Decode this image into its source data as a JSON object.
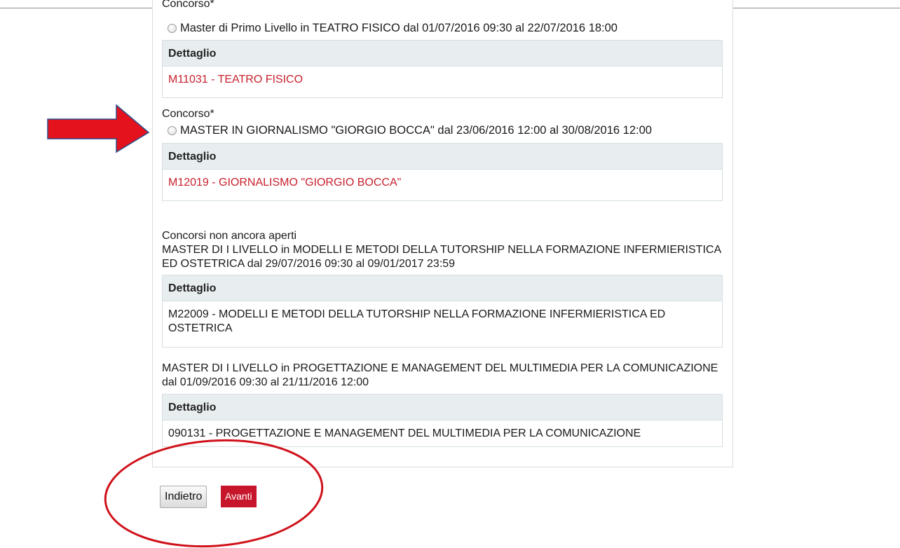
{
  "sections": {
    "open": [
      {
        "label": "Concorso*",
        "option": "Master di Primo Livello in TEATRO FISICO dal 01/07/2016 09:30 al 22/07/2016 18:00",
        "detail_header": "Dettaglio",
        "detail_value": "M11031 - TEATRO FISICO"
      },
      {
        "label": "Concorso*",
        "option": "MASTER IN GIORNALISMO \"GIORGIO BOCCA\" dal 23/06/2016 12:00 al 30/08/2016 12:00",
        "detail_header": "Dettaglio",
        "detail_value": "M12019 - GIORNALISMO \"GIORGIO BOCCA\""
      }
    ],
    "not_open_title": "Concorsi non ancora aperti",
    "not_open": [
      {
        "description": "MASTER DI I LIVELLO in MODELLI E METODI DELLA TUTORSHIP NELLA FORMAZIONE INFERMIERISTICA ED OSTETRICA dal 29/07/2016 09:30 al 09/01/2017 23:59",
        "detail_header": "Dettaglio",
        "detail_value": "M22009 - MODELLI E METODI DELLA TUTORSHIP NELLA FORMAZIONE INFERMIERISTICA ED OSTETRICA"
      },
      {
        "description": "MASTER DI I LIVELLO in PROGETTAZIONE E MANAGEMENT DEL MULTIMEDIA PER LA COMUNICAZIONE dal 01/09/2016 09:30 al 21/11/2016 12:00",
        "detail_header": "Dettaglio",
        "detail_value": "090131 - PROGETTAZIONE E MANAGEMENT DEL MULTIMEDIA PER LA COMUNICAZIONE"
      }
    ]
  },
  "buttons": {
    "back": "Indietro",
    "next": "Avanti"
  },
  "colors": {
    "accent": "#c7162b",
    "link_red": "#c8202c",
    "detail_header_bg": "#e8eef0",
    "annotation_red": "#d0121b"
  },
  "annotations": {
    "arrow_icon": "red-arrow-icon",
    "circle_icon": "red-circle-icon"
  }
}
